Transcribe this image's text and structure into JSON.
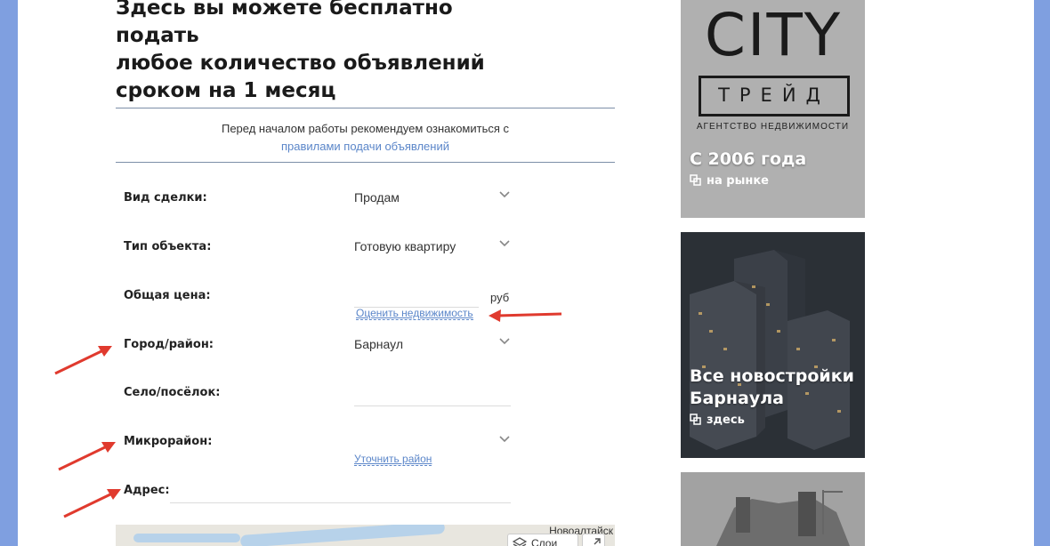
{
  "heading": {
    "line1": "Здесь вы можете бесплатно подать",
    "line2": "любое количество объявлений",
    "line3": "сроком на 1 месяц"
  },
  "notice": {
    "text": "Перед началом работы рекомендуем ознакомиться с",
    "link": "правилами подачи объявлений"
  },
  "form": {
    "deal_type": {
      "label": "Вид сделки:",
      "value": "Продам"
    },
    "object_type": {
      "label": "Тип объекта:",
      "value": "Готовую квартиру"
    },
    "price": {
      "label": "Общая цена:",
      "unit": "руб",
      "link": "Оценить недвижимость"
    },
    "city": {
      "label": "Город/район:",
      "value": "Барнаул"
    },
    "village": {
      "label": "Село/посёлок:"
    },
    "microdistrict": {
      "label": "Микрорайон:",
      "link": "Уточнить район"
    },
    "address": {
      "label": "Адрес:"
    }
  },
  "map": {
    "place_label": "Новоалтайск",
    "layers_label": "Слои"
  },
  "ads": [
    {
      "logo_main": "CITY",
      "logo_sub": "ТРЕЙД",
      "logo_caption": "АГЕНТСТВО НЕДВИЖИМОСТИ",
      "headline": "С 2006 года",
      "sub": "на рынке"
    },
    {
      "headline_line1": "Все новостройки",
      "headline_line2": "Барнаула",
      "sub": "здесь"
    }
  ],
  "colors": {
    "page_background": "#7f9fe0",
    "link": "#5b86c9",
    "arrow": "#e03a2e",
    "divider": "#7c8fa8"
  }
}
